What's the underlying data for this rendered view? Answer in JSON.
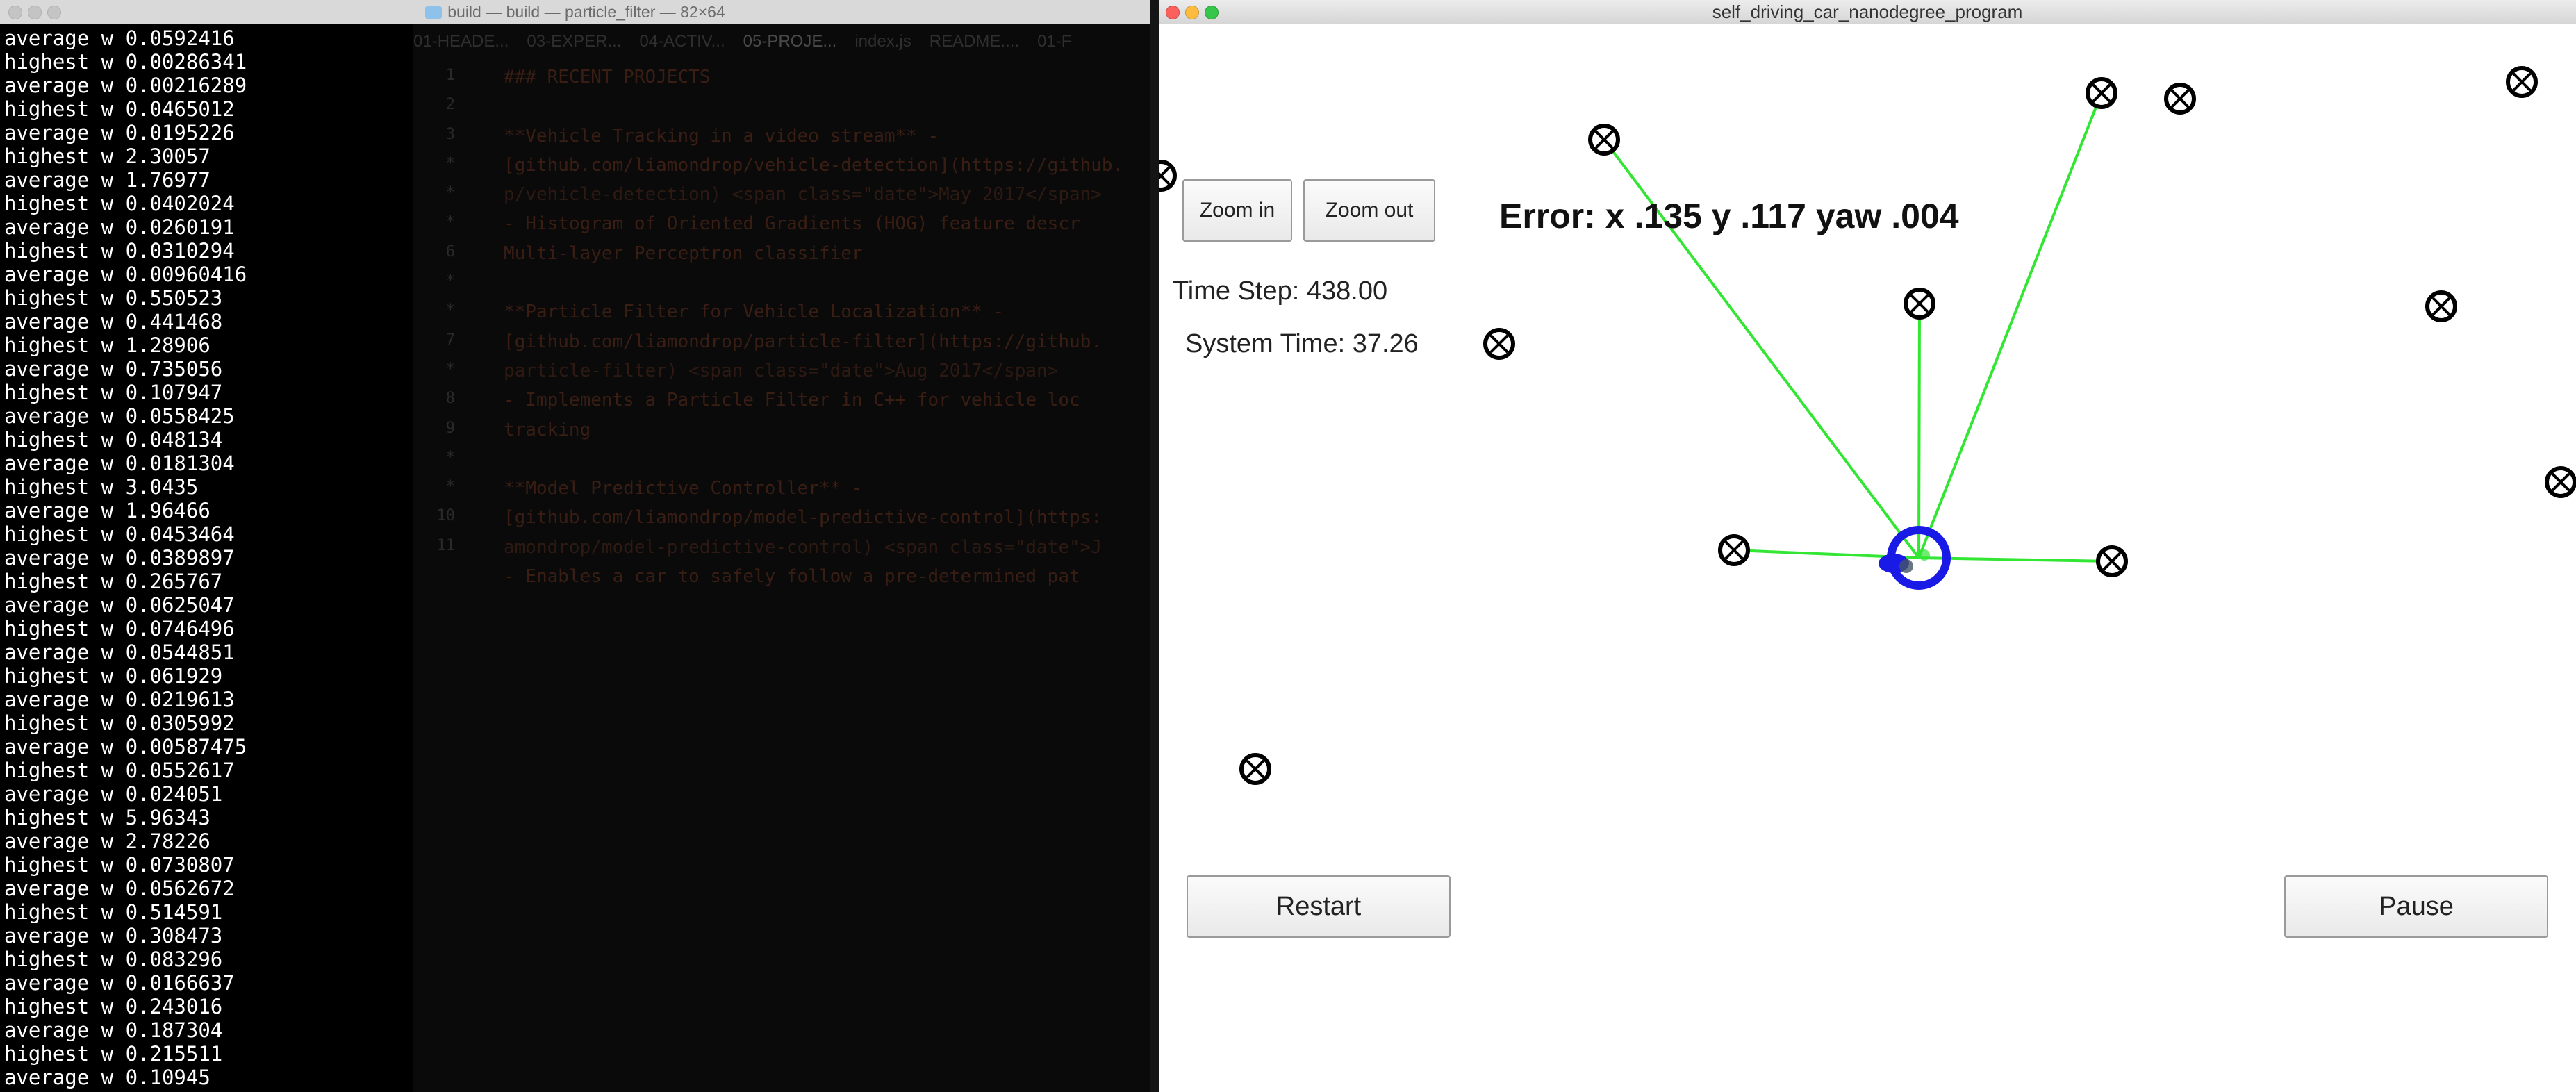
{
  "terminal": {
    "title": "build — build — particle_filter — 82×64",
    "lines": [
      "average w 0.0592416",
      "highest w 0.00286341",
      "average w 0.00216289",
      "highest w 0.0465012",
      "average w 0.0195226",
      "highest w 2.30057",
      "average w 1.76977",
      "highest w 0.0402024",
      "average w 0.0260191",
      "highest w 0.0310294",
      "average w 0.00960416",
      "highest w 0.550523",
      "average w 0.441468",
      "highest w 1.28906",
      "average w 0.735056",
      "highest w 0.107947",
      "average w 0.0558425",
      "highest w 0.048134",
      "average w 0.0181304",
      "highest w 3.0435",
      "average w 1.96466",
      "highest w 0.0453464",
      "average w 0.0389897",
      "highest w 0.265767",
      "average w 0.0625047",
      "highest w 0.0746496",
      "average w 0.0544851",
      "highest w 0.061929",
      "average w 0.0219613",
      "highest w 0.0305992",
      "average w 0.00587475",
      "highest w 0.0552617",
      "average w 0.024051",
      "highest w 5.96343",
      "average w 2.78226",
      "highest w 0.0730807",
      "average w 0.0562672",
      "highest w 0.514591",
      "average w 0.308473",
      "highest w 0.083296",
      "average w 0.0166637",
      "highest w 0.243016",
      "average w 0.187304",
      "highest w 0.215511",
      "average w 0.10945"
    ]
  },
  "background_editor": {
    "tabs": [
      "01-HEADE...",
      "03-EXPER...",
      "04-ACTIV...",
      "05-PROJE...",
      "index.js",
      "README....",
      "01-F"
    ],
    "line_numbers": [
      "1",
      "2",
      "3",
      "*",
      "*",
      "*",
      "6",
      "*",
      "*",
      "7",
      "*",
      "8",
      "9",
      "*",
      "*",
      "10",
      "11"
    ],
    "lines": [
      "### RECENT PROJECTS",
      "",
      "**Vehicle Tracking in a video stream** -",
      "[github.com/liamondrop/vehicle-detection](https://github.",
      "p/vehicle-detection) <span class=\"date\">May 2017</span>",
      "  - Histogram of Oriented Gradients (HOG) feature descr",
      "  Multi-layer Perceptron classifier",
      "",
      "**Particle Filter for Vehicle Localization** -",
      "[github.com/liamondrop/particle-filter](https://github.",
      "particle-filter) <span class=\"date\">Aug 2017</span>",
      "  - Implements a Particle Filter in C++ for vehicle loc",
      "  tracking",
      "",
      "**Model Predictive Controller** -",
      "[github.com/liamondrop/model-predictive-control](https:",
      "amondrop/model-predictive-control) <span class=\"date\">J",
      "  - Enables a car to safely follow a pre-determined pat"
    ]
  },
  "simulator": {
    "title": "self_driving_car_nanodegree_program",
    "zoom_in_label": "Zoom in",
    "zoom_out_label": "Zoom out",
    "time_step_text": "Time Step: 438.00",
    "system_time_text": "System Time: 37.26",
    "error_text": "Error: x .135 y .117 yaw .004",
    "restart_label": "Restart",
    "pause_label": "Pause",
    "colors": {
      "observation_line": "#33e633",
      "car": "#1a1ae6",
      "landmark": "#000000",
      "close": "#fc605c",
      "minimize": "#fdbc40",
      "zoom": "#34c749"
    },
    "landmark_icon": "circle-x-icon",
    "car_icon": "car-blue-circle-icon"
  }
}
